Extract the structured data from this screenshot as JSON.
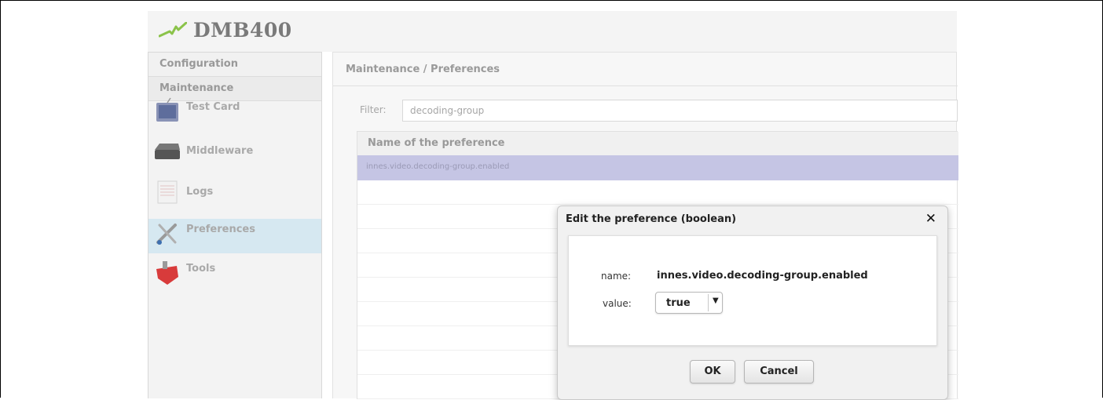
{
  "app": {
    "title": "DMB400"
  },
  "sidebar": {
    "sections": [
      "Configuration",
      "Maintenance"
    ],
    "items": [
      {
        "label": "Test Card",
        "icon": "tv-icon"
      },
      {
        "label": "Middleware",
        "icon": "device-icon"
      },
      {
        "label": "Logs",
        "icon": "document-icon"
      },
      {
        "label": "Preferences",
        "icon": "tools-icon",
        "active": true
      },
      {
        "label": "Tools",
        "icon": "toolbox-icon"
      }
    ]
  },
  "main": {
    "breadcrumb": "Maintenance / Preferences",
    "filter": {
      "label": "Filter:",
      "value": "decoding-group"
    },
    "table": {
      "header": "Name of the preference",
      "rows": [
        "innes.video.decoding-group.enabled"
      ]
    }
  },
  "dialog": {
    "title": "Edit the preference (boolean)",
    "name_label": "name:",
    "name_value": "innes.video.decoding-group.enabled",
    "value_label": "value:",
    "value_selected": "true",
    "ok_label": "OK",
    "cancel_label": "Cancel",
    "close_glyph": "✕"
  },
  "colors": {
    "accent_logo": "#7cc242",
    "selected_row": "#c5c5e4",
    "active_nav": "#d6e8f1"
  }
}
